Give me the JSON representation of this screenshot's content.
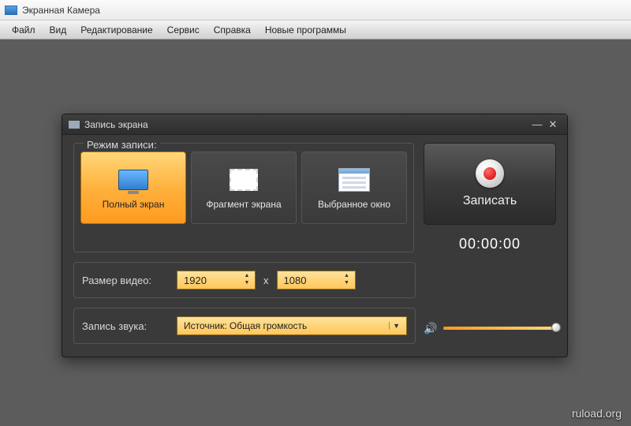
{
  "window": {
    "title": "Экранная Камера"
  },
  "menu": {
    "file": "Файл",
    "view": "Вид",
    "edit": "Редактирование",
    "service": "Сервис",
    "help": "Справка",
    "new_programs": "Новые программы"
  },
  "dialog": {
    "title": "Запись экрана",
    "mode_label": "Режим записи:",
    "modes": {
      "full": "Полный экран",
      "fragment": "Фрагмент экрана",
      "window": "Выбранное окно"
    },
    "record_label": "Записать",
    "timer": "00:00:00",
    "size_label": "Размер видео:",
    "width": "1920",
    "height": "1080",
    "xsep": "x",
    "audio_label": "Запись звука:",
    "audio_source": "Источник: Общая громкость"
  },
  "watermark": "ruload.org"
}
